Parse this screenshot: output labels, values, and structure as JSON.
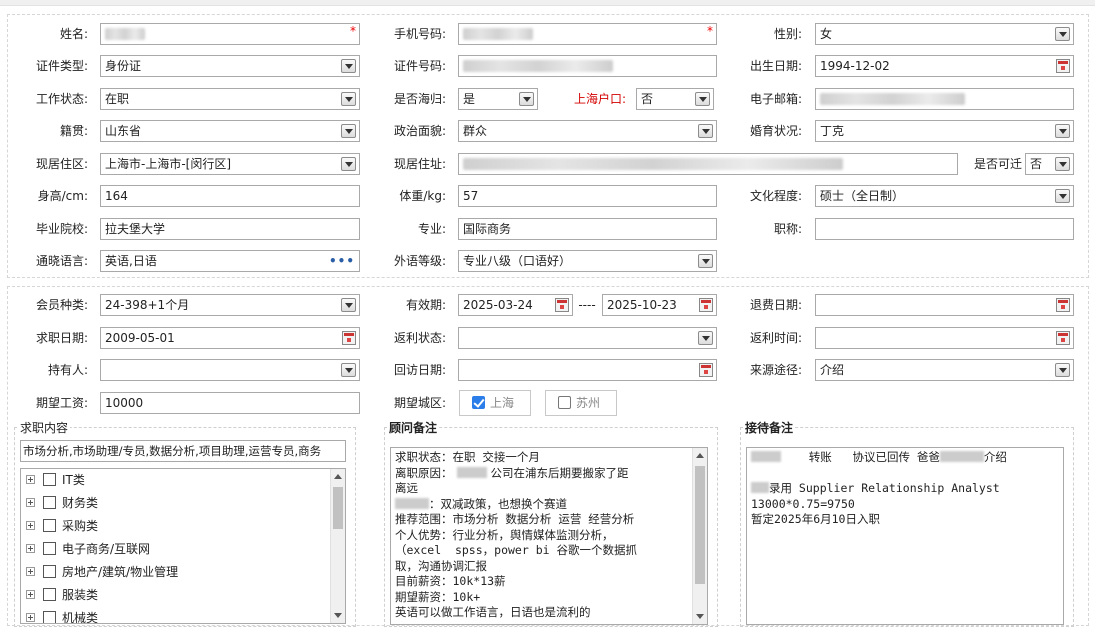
{
  "basic": {
    "name_label": "姓名:",
    "phone_label": "手机号码:",
    "gender_label": "性别:",
    "gender_value": "女",
    "idtype_label": "证件类型:",
    "idtype_value": "身份证",
    "idno_label": "证件号码:",
    "birth_label": "出生日期:",
    "birth_value": "1994-12-02",
    "work_label": "工作状态:",
    "work_value": "在职",
    "returnee_label": "是否海归:",
    "returnee_value": "是",
    "shhukou_label": "上海户口:",
    "shhukou_value": "否",
    "email_label": "电子邮箱:",
    "origin_label": "籍贯:",
    "origin_value": "山东省",
    "political_label": "政治面貌:",
    "political_value": "群众",
    "marital_label": "婚育状况:",
    "marital_value": "丁克",
    "residence_area_label": "现居住区:",
    "residence_area_value": "上海市-上海市-[闵行区]",
    "residence_addr_label": "现居住址:",
    "relocate_label": "是否可迁",
    "relocate_value": "否",
    "height_label": "身高/cm:",
    "height_value": "164",
    "weight_label": "体重/kg:",
    "weight_value": "57",
    "edu_label": "文化程度:",
    "edu_value": "硕士（全日制）",
    "school_label": "毕业院校:",
    "school_value": "拉夫堡大学",
    "major_label": "专业:",
    "major_value": "国际商务",
    "title_label": "职称:",
    "lang_label": "通晓语言:",
    "lang_value": "英语,日语",
    "lang_more": "•••",
    "foreign_label": "外语等级:",
    "foreign_value": "专业八级（口语好）"
  },
  "member": {
    "type_label": "会员种类:",
    "type_value": "24-398+1个月",
    "valid_label": "有效期:",
    "valid_from": "2025-03-24",
    "valid_sep": "----",
    "valid_to": "2025-10-23",
    "refund_date_label": "退费日期:",
    "seek_date_label": "求职日期:",
    "seek_date_value": "2009-05-01",
    "rebate_status_label": "返利状态:",
    "rebate_time_label": "返利时间:",
    "holder_label": "持有人:",
    "revisit_label": "回访日期:",
    "source_label": "来源途径:",
    "source_value": "介绍",
    "salary_label": "期望工资:",
    "salary_value": "10000",
    "city_label": "期望城区:",
    "cities": [
      {
        "label": "上海",
        "checked": true
      },
      {
        "label": "苏州",
        "checked": false
      }
    ]
  },
  "job": {
    "legend": "求职内容",
    "summary": "市场分析,市场助理/专员,数据分析,项目助理,运营专员,商务",
    "tree": [
      "IT类",
      "财务类",
      "采购类",
      "电子商务/互联网",
      "房地产/建筑/物业管理",
      "服装类",
      "机械类"
    ]
  },
  "advisor": {
    "legend": "顾问备注",
    "lines": [
      "求职状态：在职 交接一个月",
      "离职原因：",
      "公司在浦东后期要搬家了距",
      "离远",
      "：双减政策，也想换个赛道",
      "推荐范围：市场分析 数据分析 运营 经营分析",
      "个人优势：行业分析，舆情媒体监测分析，",
      "（excel  spss，power bi 谷歌一个数据抓",
      "取，沟通协调汇报",
      "目前薪资：10k*13薪",
      "期望薪资：10k+",
      "英语可以做工作语言，日语也是流利的"
    ]
  },
  "reception": {
    "legend": "接待备注",
    "l1a": "转账",
    "l1b": "协议已回传 爸爸",
    "l1c": "介绍",
    "l2": "录用 Supplier Relationship Analyst",
    "l3": "13000*0.75=9750",
    "l4": "暂定2025年6月10日入职"
  }
}
